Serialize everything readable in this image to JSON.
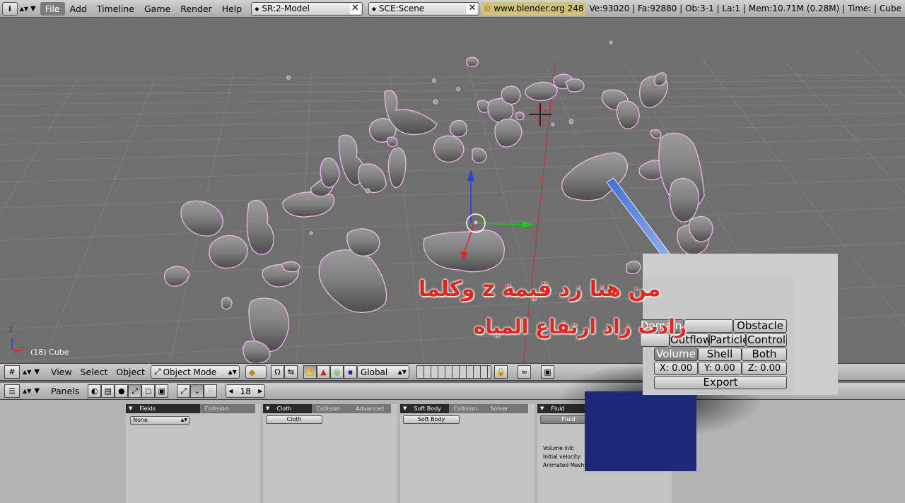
{
  "topbar": {
    "menu": [
      "File",
      "Add",
      "Timeline",
      "Game",
      "Render",
      "Help"
    ],
    "screen_field": "SR:2-Model",
    "scene_field": "SCE:Scene",
    "url": "www.blender.org 248",
    "stats": "Ve:93020 | Fa:92880 | Ob:3-1 | La:1  | Mem:10.71M (0.28M)  | Time: | Cube"
  },
  "viewport": {
    "object_label": "(18) Cube",
    "axis_z": "Z",
    "axis_x": "X"
  },
  "view3d_header": {
    "menus": [
      "View",
      "Select",
      "Object"
    ],
    "mode": "Object Mode",
    "orientation": "Global"
  },
  "buttons_header": {
    "label": "Panels",
    "frame": "18"
  },
  "panels": {
    "fields": {
      "tabs": [
        "Fields",
        "Collision"
      ],
      "dropdown": "None"
    },
    "cloth": {
      "tabs": [
        "Cloth",
        "Collision",
        "Advanced"
      ],
      "button": "Cloth"
    },
    "softbody": {
      "tabs": [
        "Soft Body",
        "Collision",
        "Solver"
      ],
      "button": "Soft Body"
    },
    "fluid": {
      "tabs": [
        "Fluid"
      ],
      "button": "Fluid",
      "labels": [
        "Volume init:",
        "Initial velocity:",
        "Animated Mesh:"
      ]
    }
  },
  "zoom_overlay": {
    "row1": [
      "Domain",
      "Obstacle"
    ],
    "row2": [
      "Outflow",
      "Particle",
      "Control"
    ],
    "row3": [
      "Volume",
      "Shell",
      "Both"
    ],
    "row4": [
      "X: 0.00",
      "Y: 0.00",
      "Z: 0.00"
    ],
    "export": "Export"
  },
  "caption": {
    "line1": "من هنا زد قيمة z وكلما",
    "line2": "زادت زاد ارتفاع المياه"
  },
  "colors": {
    "caption": "#e0261f",
    "selection_outline": "#ffaaff",
    "url_box": "#cfc37a"
  }
}
